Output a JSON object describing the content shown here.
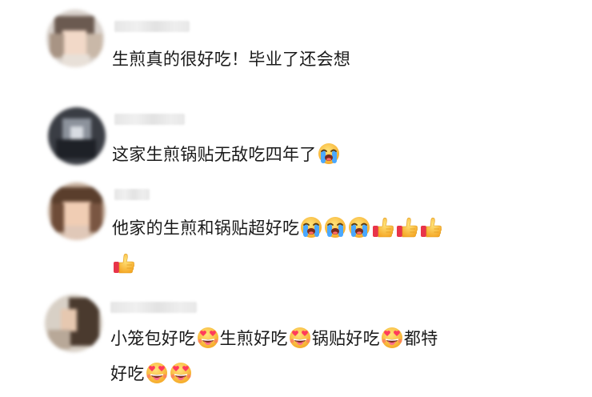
{
  "comments": [
    {
      "text_line1": "生煎真的很好吃！毕业了还会想",
      "emojis_line1": [],
      "text_line2": "",
      "emojis_line2": []
    },
    {
      "text_line1": "这家生煎锅贴无敌吃四年了",
      "emojis_line1": [
        "loudly-crying-face-emoji"
      ],
      "text_line2": "",
      "emojis_line2": []
    },
    {
      "text_line1": "他家的生煎和锅贴超好吃",
      "emojis_line1": [
        "loudly-crying-face-emoji",
        "loudly-crying-face-emoji",
        "loudly-crying-face-emoji",
        "thumbs-up-emoji",
        "thumbs-up-emoji",
        "thumbs-up-emoji"
      ],
      "text_line2": "",
      "emojis_line2": [
        "thumbs-up-emoji"
      ]
    },
    {
      "segments_line1": [
        "小笼包好吃",
        "生煎好吃",
        "锅贴好吃",
        "都特"
      ],
      "emoji_between": "drooling-heart-eyes-emoji",
      "text_line2": "好吃",
      "emojis_line2": [
        "drooling-heart-eyes-emoji",
        "drooling-heart-eyes-emoji"
      ]
    }
  ],
  "colors": {
    "text": "#1a1a1a",
    "background": "#ffffff",
    "emoji_yellow": "#ffcc3a",
    "emoji_tear": "#4aa8ff",
    "thumb_cuff": "#e8344a",
    "heart": "#ff3b5c"
  }
}
